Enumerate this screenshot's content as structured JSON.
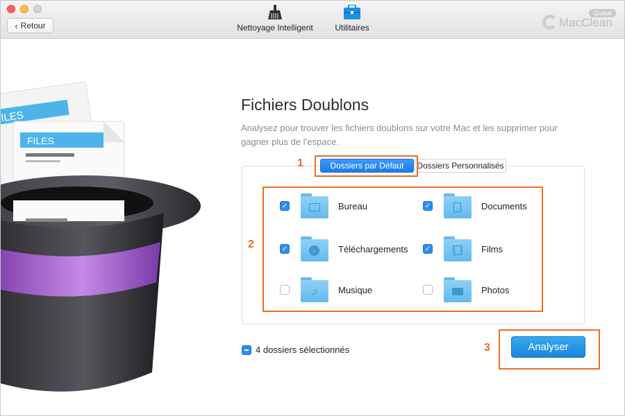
{
  "window": {
    "back_label": "Retour",
    "nav": [
      {
        "label": "Nettoyage Intelligent",
        "icon": "broom-icon"
      },
      {
        "label": "Utilitaires",
        "icon": "toolbox-icon"
      }
    ],
    "brand": {
      "name": "MacClean",
      "badge": "Gratuit"
    }
  },
  "main": {
    "title": "Fichiers Doublons",
    "description": "Analysez pour trouver les fichiers doublons sur votre Mac et les supprimer pour gagner plus de l’espace.",
    "tabs": [
      {
        "label": "Dossiers par Défaut",
        "active": true
      },
      {
        "label": "Dossiers Personnalisés",
        "active": false
      }
    ],
    "folders": [
      {
        "label": "Bureau",
        "checked": true,
        "icon": "desktop-folder-icon"
      },
      {
        "label": "Documents",
        "checked": true,
        "icon": "documents-folder-icon"
      },
      {
        "label": "Téléchargements",
        "checked": true,
        "icon": "downloads-folder-icon"
      },
      {
        "label": "Films",
        "checked": true,
        "icon": "movies-folder-icon"
      },
      {
        "label": "Musique",
        "checked": false,
        "icon": "music-folder-icon"
      },
      {
        "label": "Photos",
        "checked": false,
        "icon": "photos-folder-icon"
      }
    ],
    "selection_status": "4 dossiers sélectionnés",
    "analyse_label": "Analyser"
  },
  "annotations": {
    "step1": "1",
    "step2": "2",
    "step3": "3"
  },
  "illustration": {
    "file_label_front": "FILES",
    "file_label_back": "ILES"
  },
  "colors": {
    "accent": "#1c7be9",
    "highlight": "#ee6b23",
    "folder": "#63b9ee",
    "hat_band": "#a65fd0"
  }
}
